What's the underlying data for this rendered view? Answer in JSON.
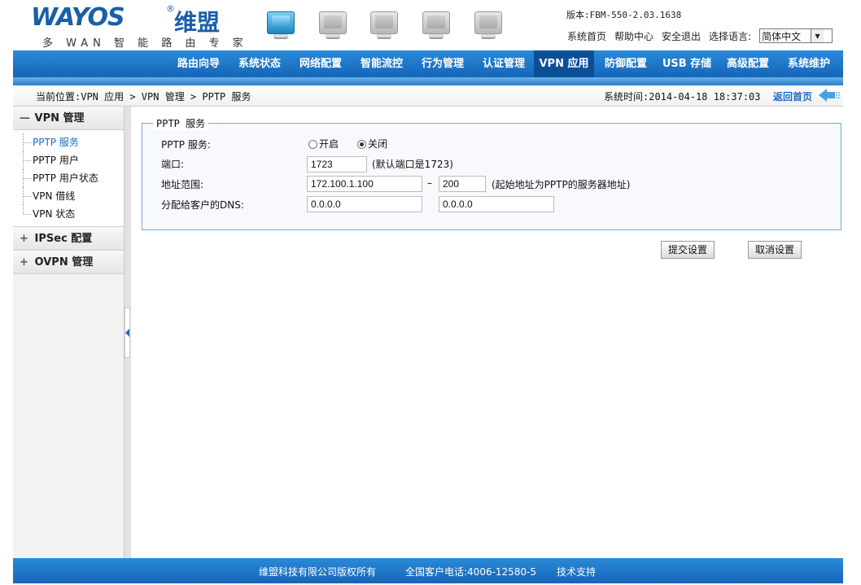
{
  "header": {
    "logo_main": "WAYOS",
    "logo_cn": "维盟",
    "logo_reg": "®",
    "logo_sub": "多 WAN 智 能 路 由 专 家",
    "version": "版本:FBM-550-2.03.1638",
    "links": [
      "系统首页",
      "帮助中心",
      "安全退出",
      "选择语言:"
    ],
    "language": "简体中文"
  },
  "nav": {
    "items": [
      "路由向导",
      "系统状态",
      "网络配置",
      "智能流控",
      "行为管理",
      "认证管理",
      "VPN 应用",
      "防御配置",
      "USB 存储",
      "高级配置",
      "系统维护"
    ],
    "active_index": 6
  },
  "crumb": {
    "path": "当前位置:VPN 应用 > VPN 管理 > PPTP 服务",
    "systime": "系统时间:2014-04-18 18:37:03",
    "back": "返回首页"
  },
  "sidebar": {
    "groups": [
      {
        "sign": "—",
        "label": "VPN 管理",
        "items": [
          "PPTP 服务",
          "PPTP 用户",
          "PPTP 用户状态",
          "VPN 借线",
          "VPN 状态"
        ]
      },
      {
        "sign": "+",
        "label": "IPSec 配置"
      },
      {
        "sign": "+",
        "label": "OVPN 管理"
      }
    ]
  },
  "form": {
    "legend": "PPTP 服务",
    "service_label": "PPTP 服务:",
    "radio_on": "开启",
    "radio_off": "关闭",
    "selected": "off",
    "port_label": "端口:",
    "port_value": "1723",
    "port_hint": "(默认端口是1723)",
    "range_label": "地址范围:",
    "range_start": "172.100.1.100",
    "range_dash": "–",
    "range_end": "200",
    "range_hint": "(起始地址为PPTP的服务器地址)",
    "dns_label": "分配给客户的DNS:",
    "dns1": "0.0.0.0",
    "dns2": "0.0.0.0",
    "submit": "提交设置",
    "cancel": "取消设置"
  },
  "footer": {
    "copyright": "维盟科技有限公司版权所有",
    "phone": "全国客户电话:4006-12580-5",
    "support": "技术支持"
  },
  "colors": {
    "nav_blue": "#1a72c8",
    "nav_active": "#0c4f99",
    "link_blue": "#1a6cc0"
  }
}
